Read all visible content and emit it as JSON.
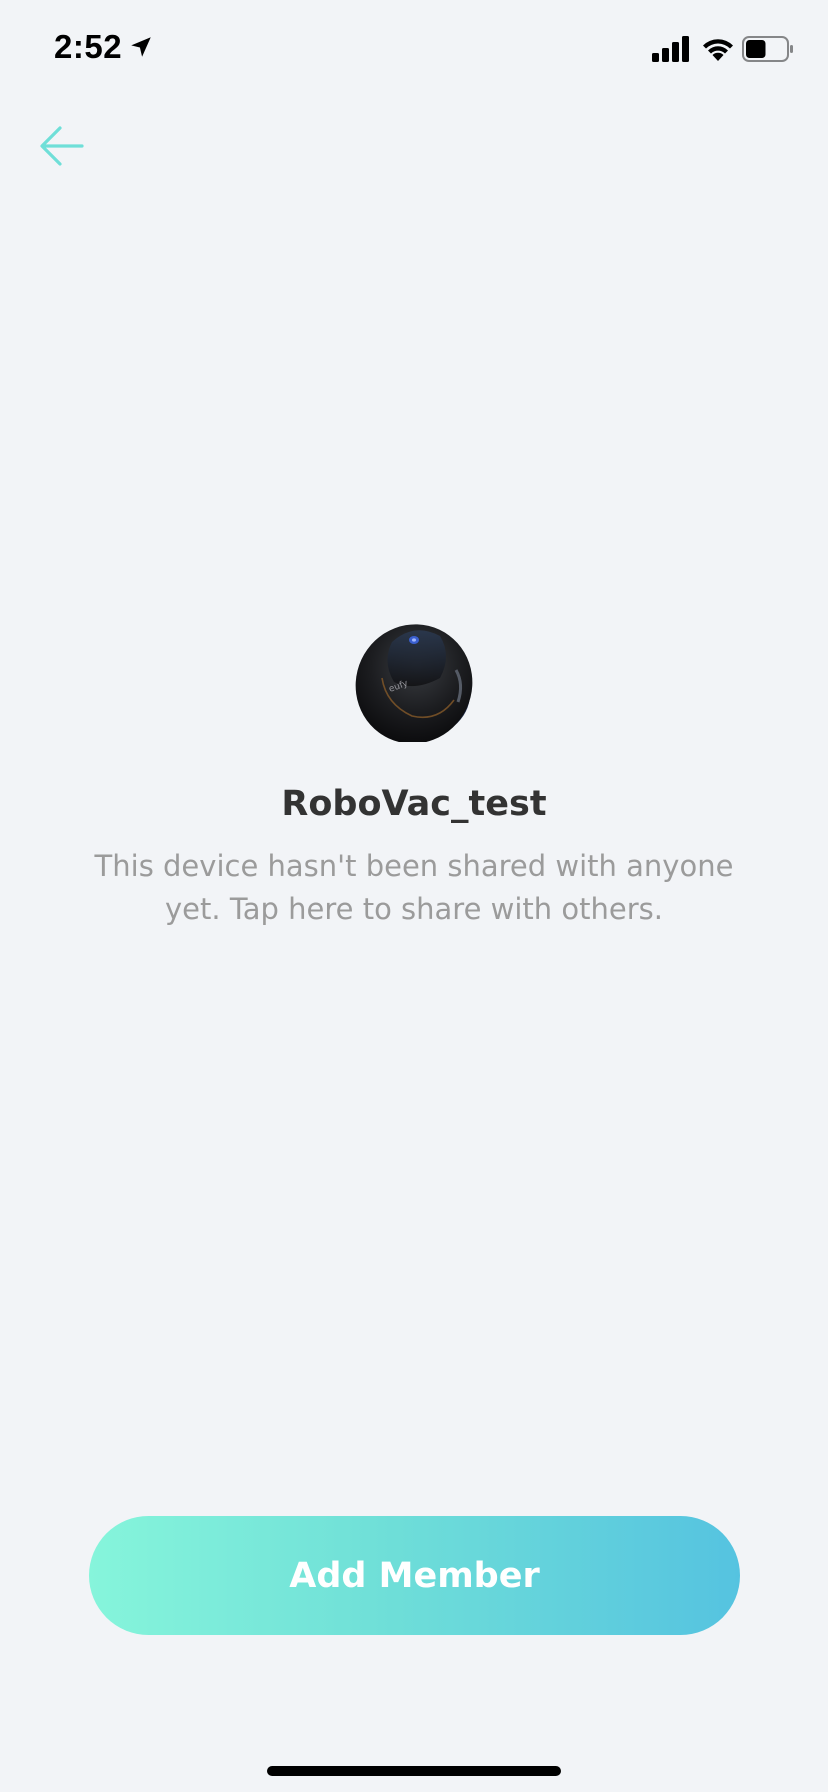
{
  "status_bar": {
    "time": "2:52",
    "icons": [
      "location-arrow-icon",
      "cellular-signal-icon",
      "wifi-icon",
      "battery-icon"
    ],
    "battery_level": 0.5
  },
  "nav": {
    "back_icon": "arrow-left-icon"
  },
  "device": {
    "image": "robot-vacuum-image",
    "name": "RoboVac_test",
    "message": "This device hasn't been shared with anyone yet. Tap here to share with others."
  },
  "actions": {
    "add_member_label": "Add Member"
  },
  "colors": {
    "accent": "#6fdfd8",
    "gradient_start": "#86f5db",
    "gradient_end": "#55c3e0",
    "background": "#f2f4f7",
    "title_text": "#333333",
    "secondary_text": "#9b9b9b"
  }
}
